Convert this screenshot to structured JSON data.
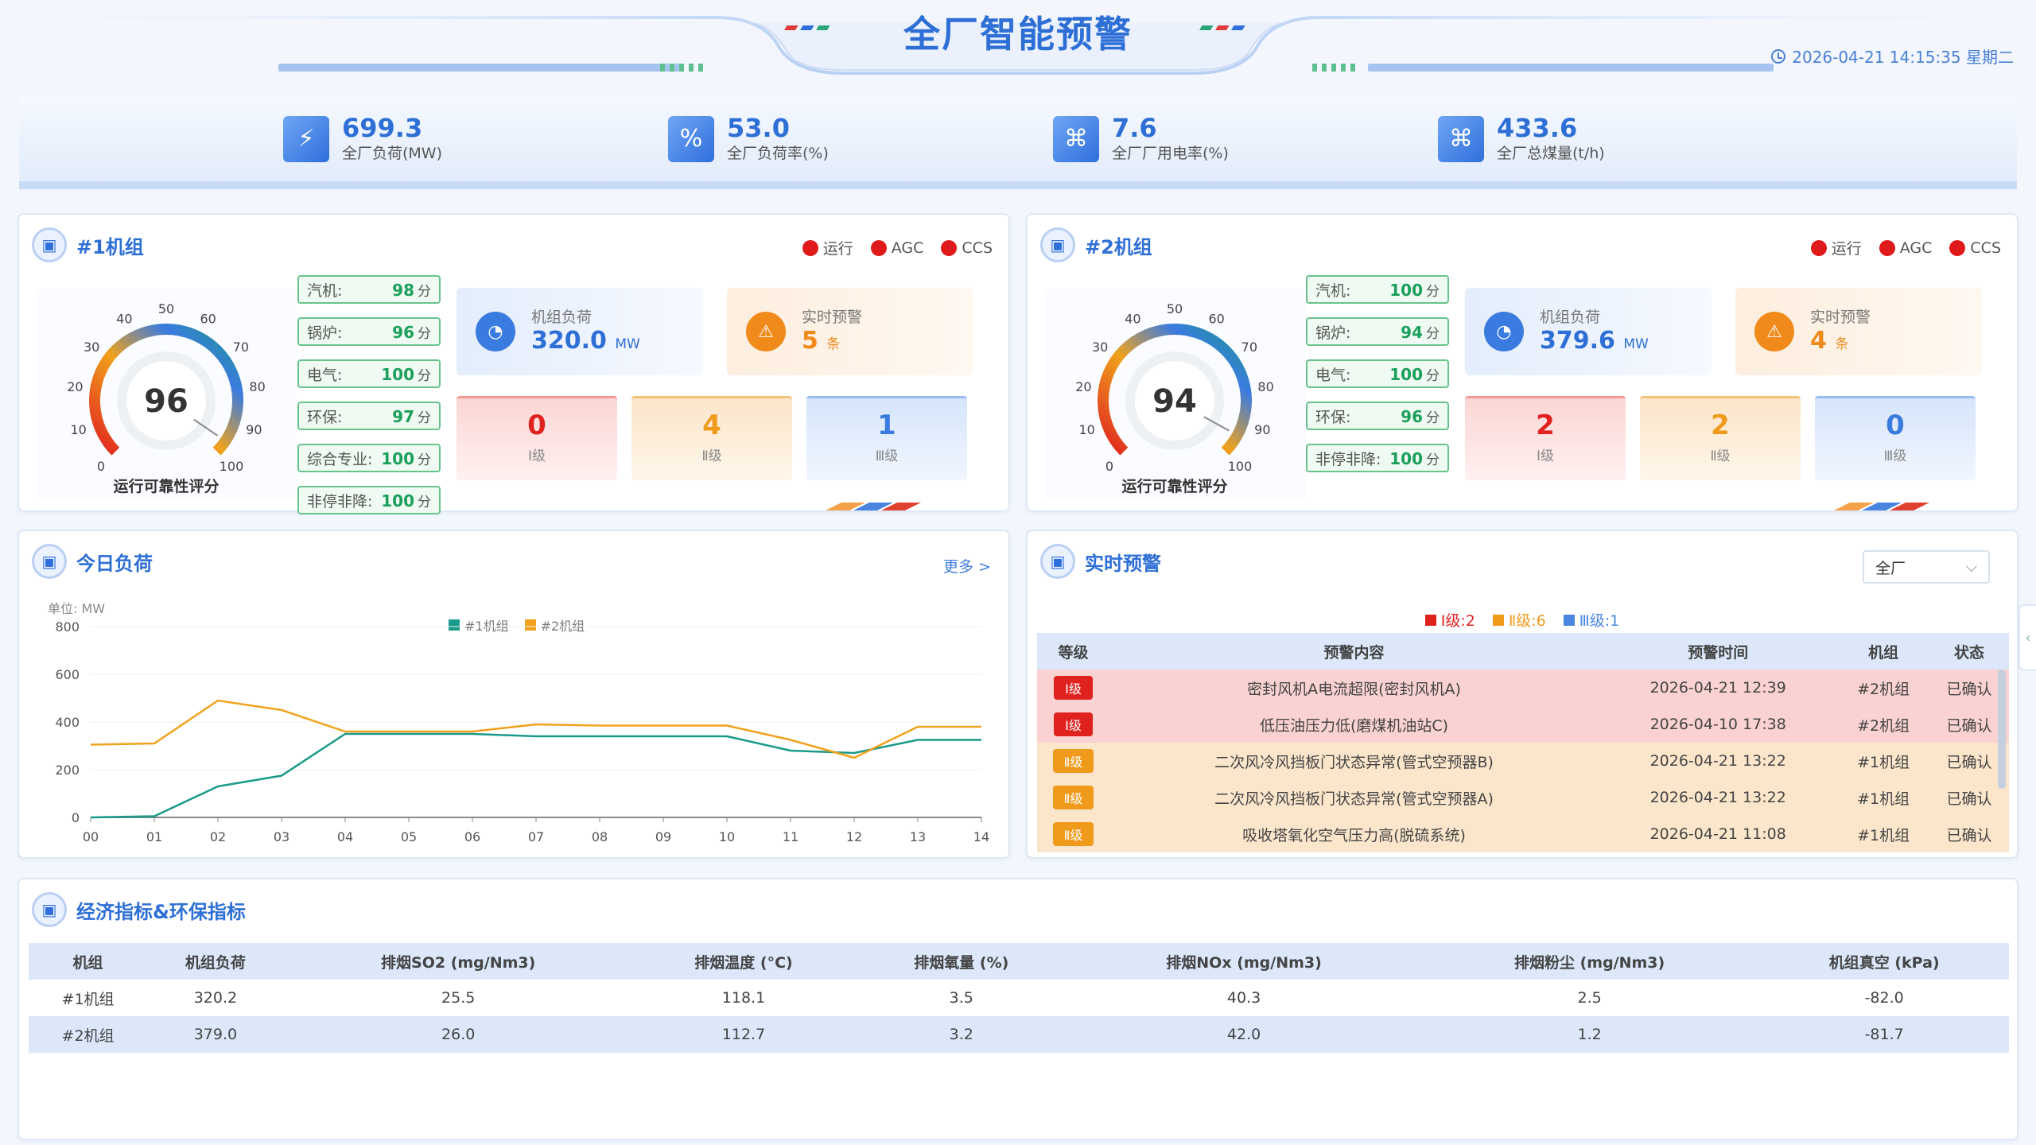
{
  "header": {
    "title": "全厂智能预警",
    "datetime": "2026-04-21 14:15:35 星期二"
  },
  "kpis": [
    {
      "value": "699.3",
      "label": "全厂负荷(MW)",
      "icon": "power-icon"
    },
    {
      "value": "53.0",
      "label": "全厂负荷率(%)",
      "icon": "percent-doc-icon"
    },
    {
      "value": "7.6",
      "label": "全厂厂用电率(%)",
      "icon": "electric-icon"
    },
    {
      "value": "433.6",
      "label": "全厂总煤量(t/h)",
      "icon": "coal-icon"
    }
  ],
  "status_labels": {
    "run": "运行",
    "agc": "AGC",
    "ccs": "CCS"
  },
  "units": [
    {
      "title": "#1机组",
      "gauge": {
        "score": "96",
        "score_value": 96,
        "label": "运行可靠性评分",
        "ticks": [
          "0",
          "10",
          "20",
          "30",
          "40",
          "50",
          "60",
          "70",
          "80",
          "90",
          "100"
        ]
      },
      "scores": [
        {
          "name": "汽机:",
          "value": "98"
        },
        {
          "name": "锅炉:",
          "value": "96"
        },
        {
          "name": "电气:",
          "value": "100"
        },
        {
          "name": "环保:",
          "value": "97"
        },
        {
          "name": "综合专业:",
          "value": "100"
        },
        {
          "name": "非停非降:",
          "value": "100"
        }
      ],
      "load_label": "机组负荷",
      "load_value": "320.0",
      "load_unit": "MW",
      "alert_label": "实时预警",
      "alert_value": "5",
      "alert_unit": "条",
      "levels": [
        {
          "num": "0",
          "label": "Ⅰ级"
        },
        {
          "num": "4",
          "label": "Ⅱ级"
        },
        {
          "num": "1",
          "label": "Ⅲ级"
        }
      ]
    },
    {
      "title": "#2机组",
      "gauge": {
        "score": "94",
        "score_value": 94,
        "label": "运行可靠性评分",
        "ticks": [
          "0",
          "10",
          "20",
          "30",
          "40",
          "50",
          "60",
          "70",
          "80",
          "90",
          "100"
        ]
      },
      "scores": [
        {
          "name": "汽机:",
          "value": "100"
        },
        {
          "name": "锅炉:",
          "value": "94"
        },
        {
          "name": "电气:",
          "value": "100"
        },
        {
          "name": "环保:",
          "value": "96"
        },
        {
          "name": "非停非降:",
          "value": "100"
        }
      ],
      "load_label": "机组负荷",
      "load_value": "379.6",
      "load_unit": "MW",
      "alert_label": "实时预警",
      "alert_value": "4",
      "alert_unit": "条",
      "levels": [
        {
          "num": "2",
          "label": "Ⅰ级"
        },
        {
          "num": "2",
          "label": "Ⅱ级"
        },
        {
          "num": "0",
          "label": "Ⅲ级"
        }
      ]
    }
  ],
  "score_unit": "分",
  "load_panel": {
    "title": "今日负荷",
    "more": "更多 >",
    "unit_label": "单位:  MW"
  },
  "chart_data": {
    "type": "line",
    "x": [
      "00",
      "01",
      "02",
      "03",
      "04",
      "05",
      "06",
      "07",
      "08",
      "09",
      "10",
      "11",
      "12",
      "13",
      "14"
    ],
    "ylim": [
      0,
      800
    ],
    "yticks": [
      "0",
      "200",
      "400",
      "600",
      "800"
    ],
    "series": [
      {
        "name": "#1机组",
        "color": "#1a9a8a",
        "values": [
          0,
          5,
          130,
          175,
          350,
          350,
          350,
          340,
          340,
          340,
          340,
          280,
          270,
          325,
          325
        ]
      },
      {
        "name": "#2机组",
        "color": "#f0a21c",
        "values": [
          305,
          310,
          490,
          450,
          360,
          360,
          360,
          390,
          385,
          385,
          385,
          325,
          250,
          380,
          380
        ]
      }
    ]
  },
  "alert_panel": {
    "title": "实时预警",
    "filter": "全厂",
    "legend": [
      {
        "text": "Ⅰ级:2",
        "color": "#e0221f"
      },
      {
        "text": "Ⅱ级:6",
        "color": "#f09a1c"
      },
      {
        "text": "Ⅲ级:1",
        "color": "#4a86e0"
      }
    ],
    "columns": [
      "等级",
      "预警内容",
      "预警时间",
      "机组",
      "状态"
    ],
    "rows": [
      {
        "level": "Ⅰ级",
        "content": "密封风机A电流超限(密封风机A)",
        "time": "2026-04-21 12:39",
        "unit": "#2机组",
        "status": "已确认"
      },
      {
        "level": "Ⅰ级",
        "content": "低压油压力低(磨煤机油站C)",
        "time": "2026-04-10 17:38",
        "unit": "#2机组",
        "status": "已确认"
      },
      {
        "level": "Ⅱ级",
        "content": "二次风冷风挡板门状态异常(管式空预器B)",
        "time": "2026-04-21 13:22",
        "unit": "#1机组",
        "status": "已确认"
      },
      {
        "level": "Ⅱ级",
        "content": "二次风冷风挡板门状态异常(管式空预器A)",
        "time": "2026-04-21 13:22",
        "unit": "#1机组",
        "status": "已确认"
      },
      {
        "level": "Ⅱ级",
        "content": "吸收塔氧化空气压力高(脱硫系统)",
        "time": "2026-04-21 11:08",
        "unit": "#1机组",
        "status": "已确认"
      }
    ]
  },
  "eco_panel": {
    "title": "经济指标&环保指标",
    "columns": [
      "机组",
      "机组负荷",
      "排烟SO2 (mg/Nm3)",
      "排烟温度 (°C)",
      "排烟氧量 (%)",
      "排烟NOx (mg/Nm3)",
      "排烟粉尘 (mg/Nm3)",
      "机组真空 (kPa)"
    ],
    "rows": [
      [
        "#1机组",
        "320.2",
        "25.5",
        "118.1",
        "3.5",
        "40.3",
        "2.5",
        "-82.0"
      ],
      [
        "#2机组",
        "379.0",
        "26.0",
        "112.7",
        "3.2",
        "42.0",
        "1.2",
        "-81.7"
      ]
    ]
  }
}
